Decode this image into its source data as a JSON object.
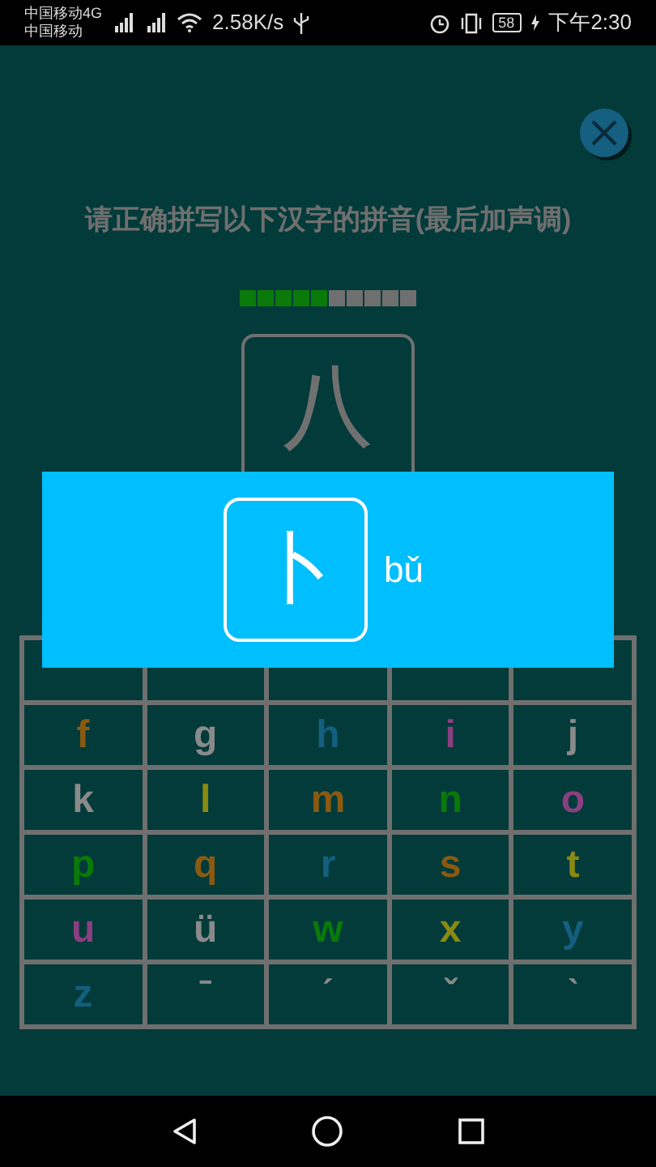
{
  "status_bar": {
    "carrier_1": "中国移动4G",
    "carrier_2": "中国移动",
    "speed": "2.58K/s",
    "battery": "58",
    "time": "下午2:30"
  },
  "instruction": "请正确拼写以下汉字的拼音(最后加声调)",
  "progress": [
    {
      "done": true
    },
    {
      "done": true
    },
    {
      "done": true
    },
    {
      "done": true
    },
    {
      "done": true
    },
    {
      "done": false
    },
    {
      "done": false
    },
    {
      "done": false
    },
    {
      "done": false
    },
    {
      "done": false
    }
  ],
  "question_character": "八",
  "popup": {
    "character": "卜",
    "pinyin": "bǔ"
  },
  "keys": [
    "f",
    "g",
    "h",
    "i",
    "j",
    "k",
    "l",
    "m",
    "n",
    "o",
    "p",
    "q",
    "r",
    "s",
    "t",
    "u",
    "ü",
    "w",
    "x",
    "y",
    "z",
    "ˉ",
    "ˊ",
    "ˇ",
    "ˋ"
  ]
}
